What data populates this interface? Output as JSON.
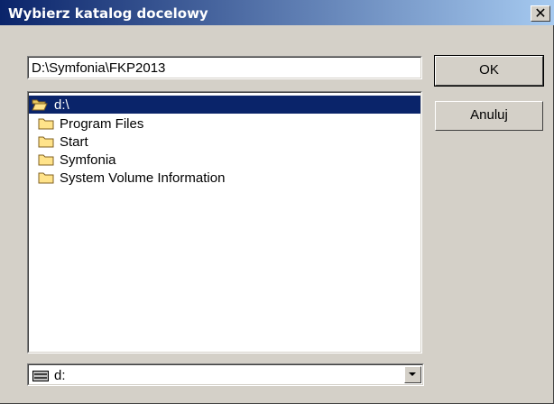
{
  "window": {
    "title": "Wybierz katalog docelowy",
    "close_glyph": "✕"
  },
  "path": {
    "value": "D:\\Symfonia\\FKP2013"
  },
  "buttons": {
    "ok_label": "OK",
    "cancel_label": "Anuluj"
  },
  "folders": [
    {
      "label": "d:\\",
      "icon": "open-folder-icon",
      "selected": true
    },
    {
      "label": "Program Files",
      "icon": "folder-icon",
      "selected": false
    },
    {
      "label": "Start",
      "icon": "folder-icon",
      "selected": false
    },
    {
      "label": "Symfonia",
      "icon": "folder-icon",
      "selected": false
    },
    {
      "label": "System Volume Information",
      "icon": "folder-icon",
      "selected": false
    }
  ],
  "drive": {
    "label": "d:",
    "icon": "drive-icon"
  },
  "colors": {
    "title_start": "#0a246a",
    "title_end": "#a6caf0",
    "selection": "#0a246a",
    "face": "#d4d0c8",
    "folder": "#ffe38a"
  }
}
